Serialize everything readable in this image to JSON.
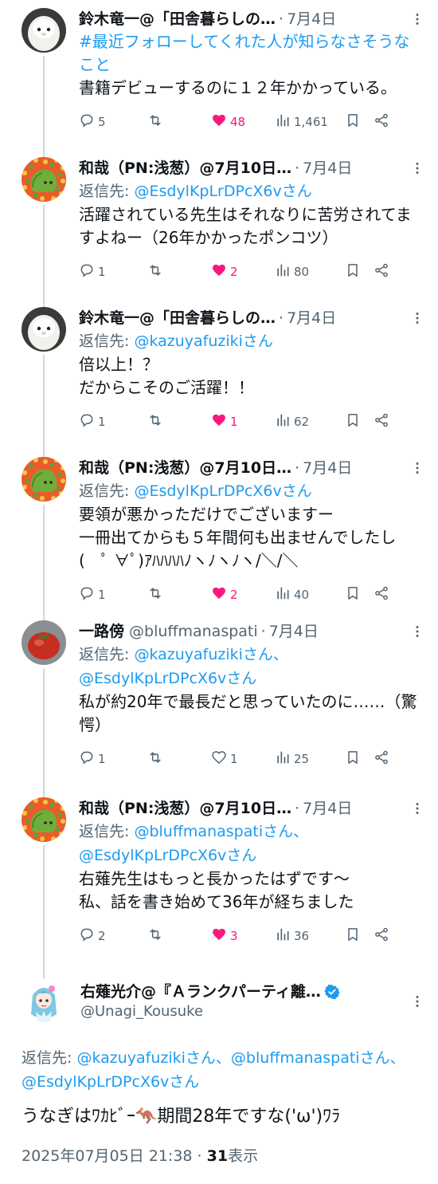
{
  "tweets": [
    {
      "avatar": "ghost-plush",
      "name": "鈴木竜一@「田舎暮らしの…",
      "handle": "",
      "date": "7月4日",
      "hashtag": "#最近フォローしてくれた人が知らなさそうなこと",
      "reply_label": "",
      "reply_to": "",
      "text": "書籍デビューするのに１２年かかっている。",
      "replies": "5",
      "retweets": "",
      "likes": "48",
      "liked": true,
      "views": "1,461"
    },
    {
      "avatar": "green-character",
      "name": "和哉（PN:浅葱）@7月10日…",
      "handle": "",
      "date": "7月4日",
      "hashtag": "",
      "reply_label": "返信先: ",
      "reply_to": "@EsdylKpLrDPcX6vさん",
      "text": "活躍されている先生はそれなりに苦労されてますよねー（26年かかったポンコツ）",
      "replies": "1",
      "retweets": "",
      "likes": "2",
      "liked": true,
      "views": "80"
    },
    {
      "avatar": "ghost-plush",
      "name": "鈴木竜一@「田舎暮らしの…",
      "handle": "",
      "date": "7月4日",
      "hashtag": "",
      "reply_label": "返信先: ",
      "reply_to": "@kazuyafuzikiさん",
      "text": "倍以上！？\nだからこそのご活躍！！",
      "replies": "1",
      "retweets": "",
      "likes": "1",
      "liked": true,
      "views": "62"
    },
    {
      "avatar": "green-character",
      "name": "和哉（PN:浅葱）@7月10日…",
      "handle": "",
      "date": "7月4日",
      "hashtag": "",
      "reply_label": "返信先: ",
      "reply_to": "@EsdylKpLrDPcX6vさん",
      "text": "要領が悪かっただけでございますー\n一冊出てからも５年間何も出ませんでしたし(　ﾟ ∀ﾟ)ｱﾊﾊﾊﾊﾉヽﾉヽﾉヽ/＼/＼",
      "replies": "1",
      "retweets": "",
      "likes": "2",
      "liked": true,
      "views": "40"
    },
    {
      "avatar": "tomato",
      "name": "一路傍",
      "handle": "@bluffmanaspati",
      "date": "7月4日",
      "hashtag": "",
      "reply_label": "返信先: ",
      "reply_to": "@kazuyafuzikiさん、@EsdylKpLrDPcX6vさん",
      "text": "私が約20年で最長だと思っていたのに……（驚愕）",
      "replies": "1",
      "retweets": "",
      "likes": "1",
      "liked": false,
      "views": "25"
    },
    {
      "avatar": "green-character",
      "name": "和哉（PN:浅葱）@7月10日…",
      "handle": "",
      "date": "7月4日",
      "hashtag": "",
      "reply_label": "返信先: ",
      "reply_to": "@bluffmanaspatiさん、@EsdylKpLrDPcX6vさん",
      "text": "右薙先生はもっと長かったはずです〜\n私、話を書き始めて36年が経ちました",
      "replies": "2",
      "retweets": "",
      "likes": "3",
      "liked": true,
      "views": "36"
    }
  ],
  "main_tweet": {
    "avatar": "anime-girl",
    "name": "右薙光介@『Ａランクパーティ離…",
    "verified": true,
    "handle": "@Unagi_Kousuke",
    "reply_label": "返信先: ",
    "reply_to": "@kazuyafuzikiさん、@bluffmanaspatiさん、@EsdylKpLrDPcX6vさん",
    "text": "うなぎはﾜｶﾋﾞｰ🦘期間28年ですな('ω')ﾜﾗ",
    "timestamp": "2025年07月05日 21:38",
    "views_count": "31",
    "views_label": "表示",
    "separator": " · "
  },
  "colors": {
    "accent": "#1d9bf0",
    "like": "#f91880",
    "muted": "#536471",
    "text": "#0f1419",
    "thread_line": "#cfd9de"
  },
  "icons": {
    "reply": "reply-icon",
    "retweet": "retweet-icon",
    "like": "heart-icon",
    "views": "views-icon",
    "bookmark": "bookmark-icon",
    "share": "share-icon",
    "more": "more-icon"
  }
}
